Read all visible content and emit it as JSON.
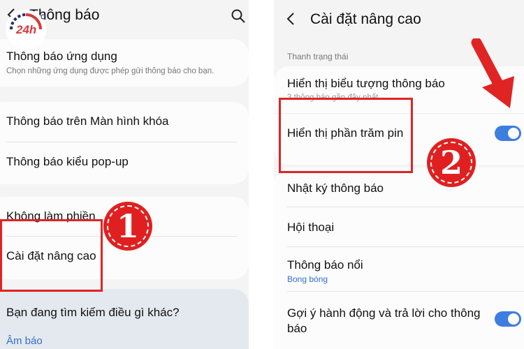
{
  "left": {
    "title": "Thông báo",
    "items": [
      {
        "label": "Thông báo ứng dụng",
        "sub": "Chọn những ứng dụng được phép gửi thông báo cho bạn."
      },
      {
        "label": "Thông báo trên Màn hình khóa"
      },
      {
        "label": "Thông báo kiểu pop-up"
      },
      {
        "label": "Không làm phiền"
      },
      {
        "label": "Cài đặt nâng cao"
      }
    ],
    "suggest_title": "Bạn đang tìm kiếm điều gì khác?",
    "suggest_link": "Âm báo",
    "step": "1"
  },
  "right": {
    "title": "Cài đặt nâng cao",
    "section": "Thanh trạng thái",
    "items": [
      {
        "label": "Hiển thị biểu tượng thông báo",
        "sub": "3 thông báo gần đây nhất"
      },
      {
        "label": "Hiển thị phần trăm pin",
        "toggle": true
      },
      {
        "label": "Nhật ký thông báo"
      },
      {
        "label": "Hội thoại"
      },
      {
        "label": "Thông báo nổi",
        "sub": "Bong bóng"
      },
      {
        "label": "Gợi ý hành động và trả lời cho thông báo",
        "toggle": true
      }
    ],
    "step": "2"
  },
  "logo": {
    "text": "24h"
  },
  "colors": {
    "accent_red": "#e02424",
    "toggle_blue": "#3e7de0",
    "link_blue": "#2f6fd1"
  }
}
